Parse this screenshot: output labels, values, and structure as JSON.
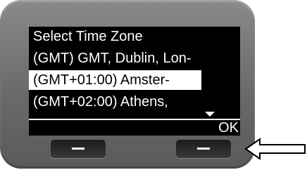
{
  "display": {
    "title": "Select Time Zone",
    "options": [
      {
        "label": "(GMT) GMT, Dublin, Lon-"
      },
      {
        "label": "(GMT+01:00) Amster-"
      },
      {
        "label": "(GMT+02:00) Athens,"
      }
    ],
    "selected_index": 1,
    "softkey_right_label": "OK"
  },
  "colors": {
    "screen_bg": "#000000",
    "text": "#ffffff",
    "highlight_bg": "#ffffff",
    "highlight_text": "#000000",
    "bezel": "#7a7a7a"
  },
  "icons": {
    "scroll": "scroll-down-icon",
    "pointer": "arrow-left-icon"
  }
}
